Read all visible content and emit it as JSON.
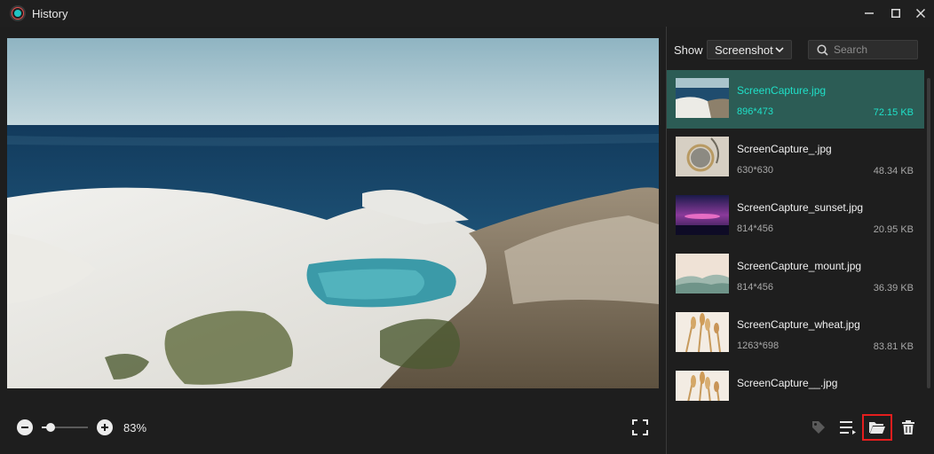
{
  "window": {
    "title": "History"
  },
  "preview": {
    "zoom_label": "83%",
    "zoom_fraction": 0.2
  },
  "panel": {
    "show_label": "Show",
    "filter_value": "Screenshot",
    "search_placeholder": "Search"
  },
  "items": [
    {
      "name": "ScreenCapture.jpg",
      "dims": "896*473",
      "size": "72.15 KB",
      "selected": true,
      "thumb": "sea"
    },
    {
      "name": "ScreenCapture_.jpg",
      "dims": "630*630",
      "size": "48.34 KB",
      "selected": false,
      "thumb": "mirror"
    },
    {
      "name": "ScreenCapture_sunset.jpg",
      "dims": "814*456",
      "size": "20.95 KB",
      "selected": false,
      "thumb": "sunset"
    },
    {
      "name": "ScreenCapture_mount.jpg",
      "dims": "814*456",
      "size": "36.39 KB",
      "selected": false,
      "thumb": "mount"
    },
    {
      "name": "ScreenCapture_wheat.jpg",
      "dims": "1263*698",
      "size": "83.81 KB",
      "selected": false,
      "thumb": "wheat"
    },
    {
      "name": "ScreenCapture__.jpg",
      "dims": "",
      "size": "",
      "selected": false,
      "thumb": "wheat"
    }
  ],
  "colors": {
    "accent": "#1fe0c8",
    "selected_bg": "#2c5c55",
    "highlight_border": "#e41e1e"
  },
  "icons": [
    "minimize-icon",
    "maximize-icon",
    "close-icon",
    "zoom-out-icon",
    "zoom-in-icon",
    "fullscreen-icon",
    "chevron-down-icon",
    "search-icon",
    "tag-icon",
    "list-icon",
    "folder-open-icon",
    "trash-icon"
  ]
}
